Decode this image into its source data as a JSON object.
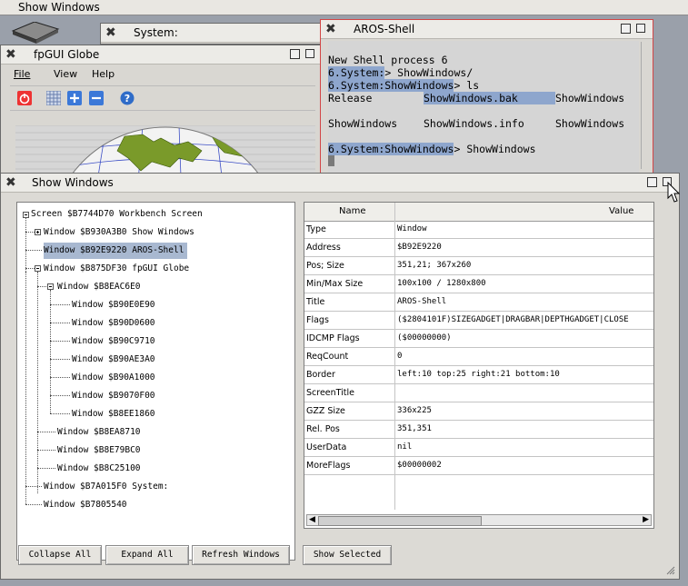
{
  "screen_title": "Show Windows",
  "system_window": {
    "title": "System:"
  },
  "globe_window": {
    "title": "fpGUI Globe",
    "menu": [
      "File",
      "View",
      "Help"
    ]
  },
  "shell": {
    "title": "AROS-Shell",
    "lines": [
      "New Shell process 6",
      "6.System:> ShowWindows/",
      "6.System:ShowWindows> ls",
      "Release       ShowWindows.bak   ShowWindows",
      "ShowWindows   ShowWindows.info  ShowWindows",
      "6.System:ShowWindows> ShowWindows"
    ],
    "prompt1": "6.System:",
    "prompt1_suffix": "> ShowWindows/",
    "prompt2": "6.System:ShowWindows",
    "prompt2_suffix": "> ls",
    "prompt3": "6.System:ShowWindows",
    "prompt3_suffix": "> ShowWindows",
    "ls_row1": [
      "Release",
      "ShowWindows.bak",
      "ShowWindows"
    ],
    "ls_row2": [
      "ShowWindows",
      "ShowWindows.info",
      "ShowWindows"
    ]
  },
  "show_windows": {
    "title": "Show Windows",
    "tree": [
      "Screen $B7744D70 Workbench Screen",
      "Window $B930A3B0 Show Windows",
      "Window $B92E9220 AROS-Shell",
      "Window $B875DF30 fpGUI Globe",
      "Window $B8EAC6E0",
      "Window $B90E0E90",
      "Window $B90D0600",
      "Window $B90C9710",
      "Window $B90AE3A0",
      "Window $B90A1000",
      "Window $B9070F00",
      "Window $B8EE1860",
      "Window $B8EA8710",
      "Window $B8E79BC0",
      "Window $B8C25100",
      "Window $B7A015F0 System:",
      "Window $B7805540"
    ],
    "columns": {
      "name": "Name",
      "value": "Value"
    },
    "properties": [
      {
        "name": "Type",
        "value": "Window"
      },
      {
        "name": "Address",
        "value": "$B92E9220"
      },
      {
        "name": "Pos; Size",
        "value": "351,21; 367x260"
      },
      {
        "name": "Min/Max Size",
        "value": "100x100 / 1280x800"
      },
      {
        "name": "Title",
        "value": "AROS-Shell"
      },
      {
        "name": "Flags",
        "value": "($2804101F)SIZEGADGET|DRAGBAR|DEPTHGADGET|CLOSE"
      },
      {
        "name": "IDCMP Flags",
        "value": "($00000000)"
      },
      {
        "name": "ReqCount",
        "value": "0"
      },
      {
        "name": "Border",
        "value": "left:10 top:25 right:21 bottom:10"
      },
      {
        "name": "ScreenTitle",
        "value": ""
      },
      {
        "name": "GZZ Size",
        "value": "336x225"
      },
      {
        "name": "Rel. Pos",
        "value": "351,351"
      },
      {
        "name": "UserData",
        "value": "nil"
      },
      {
        "name": "MoreFlags",
        "value": "$00000002"
      }
    ],
    "buttons": {
      "collapse": "Collapse All",
      "expand": "Expand All",
      "refresh": "Refresh Windows",
      "show": "Show Selected"
    }
  }
}
